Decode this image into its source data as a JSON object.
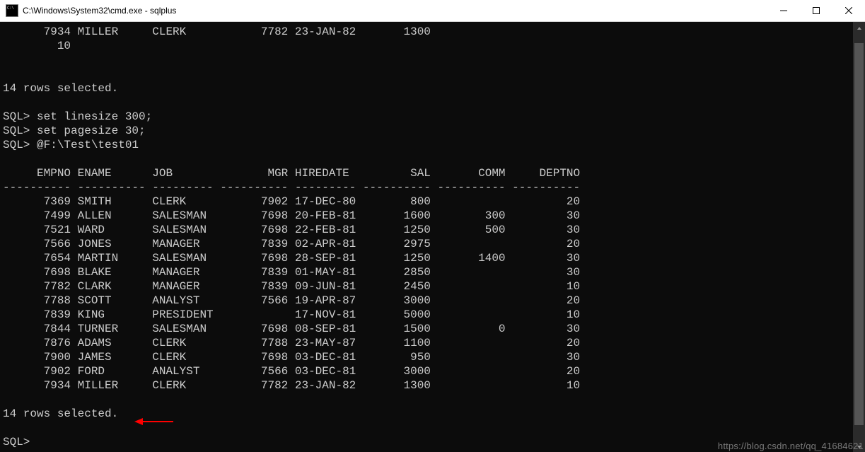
{
  "window": {
    "title": "C:\\Windows\\System32\\cmd.exe - sqlplus"
  },
  "scrollback_row": {
    "empno": "7934",
    "ename": "MILLER",
    "job": "CLERK",
    "mgr": "7782",
    "hiredate": "23-JAN-82",
    "sal": "1300",
    "comm": "",
    "deptno_wrapped": "10"
  },
  "status_above": "14 rows selected.",
  "commands": {
    "c1_prompt": "SQL>",
    "c1_text": "set linesize 300;",
    "c2_prompt": "SQL>",
    "c2_text": "set pagesize 30;",
    "c3_prompt": "SQL>",
    "c3_text": "@F:\\Test\\test01"
  },
  "headers": {
    "empno": "EMPNO",
    "ename": "ENAME",
    "job": "JOB",
    "mgr": "MGR",
    "hiredate": "HIREDATE",
    "sal": "SAL",
    "comm": "COMM",
    "deptno": "DEPTNO"
  },
  "rows": [
    {
      "empno": "7369",
      "ename": "SMITH",
      "job": "CLERK",
      "mgr": "7902",
      "hiredate": "17-DEC-80",
      "sal": "800",
      "comm": "",
      "deptno": "20"
    },
    {
      "empno": "7499",
      "ename": "ALLEN",
      "job": "SALESMAN",
      "mgr": "7698",
      "hiredate": "20-FEB-81",
      "sal": "1600",
      "comm": "300",
      "deptno": "30"
    },
    {
      "empno": "7521",
      "ename": "WARD",
      "job": "SALESMAN",
      "mgr": "7698",
      "hiredate": "22-FEB-81",
      "sal": "1250",
      "comm": "500",
      "deptno": "30"
    },
    {
      "empno": "7566",
      "ename": "JONES",
      "job": "MANAGER",
      "mgr": "7839",
      "hiredate": "02-APR-81",
      "sal": "2975",
      "comm": "",
      "deptno": "20"
    },
    {
      "empno": "7654",
      "ename": "MARTIN",
      "job": "SALESMAN",
      "mgr": "7698",
      "hiredate": "28-SEP-81",
      "sal": "1250",
      "comm": "1400",
      "deptno": "30"
    },
    {
      "empno": "7698",
      "ename": "BLAKE",
      "job": "MANAGER",
      "mgr": "7839",
      "hiredate": "01-MAY-81",
      "sal": "2850",
      "comm": "",
      "deptno": "30"
    },
    {
      "empno": "7782",
      "ename": "CLARK",
      "job": "MANAGER",
      "mgr": "7839",
      "hiredate": "09-JUN-81",
      "sal": "2450",
      "comm": "",
      "deptno": "10"
    },
    {
      "empno": "7788",
      "ename": "SCOTT",
      "job": "ANALYST",
      "mgr": "7566",
      "hiredate": "19-APR-87",
      "sal": "3000",
      "comm": "",
      "deptno": "20"
    },
    {
      "empno": "7839",
      "ename": "KING",
      "job": "PRESIDENT",
      "mgr": "",
      "hiredate": "17-NOV-81",
      "sal": "5000",
      "comm": "",
      "deptno": "10"
    },
    {
      "empno": "7844",
      "ename": "TURNER",
      "job": "SALESMAN",
      "mgr": "7698",
      "hiredate": "08-SEP-81",
      "sal": "1500",
      "comm": "0",
      "deptno": "30"
    },
    {
      "empno": "7876",
      "ename": "ADAMS",
      "job": "CLERK",
      "mgr": "7788",
      "hiredate": "23-MAY-87",
      "sal": "1100",
      "comm": "",
      "deptno": "20"
    },
    {
      "empno": "7900",
      "ename": "JAMES",
      "job": "CLERK",
      "mgr": "7698",
      "hiredate": "03-DEC-81",
      "sal": "950",
      "comm": "",
      "deptno": "30"
    },
    {
      "empno": "7902",
      "ename": "FORD",
      "job": "ANALYST",
      "mgr": "7566",
      "hiredate": "03-DEC-81",
      "sal": "3000",
      "comm": "",
      "deptno": "20"
    },
    {
      "empno": "7934",
      "ename": "MILLER",
      "job": "CLERK",
      "mgr": "7782",
      "hiredate": "23-JAN-82",
      "sal": "1300",
      "comm": "",
      "deptno": "10"
    }
  ],
  "status_below": "14 rows selected.",
  "prompt_final": "SQL>",
  "watermark": "https://blog.csdn.net/qq_41684621",
  "colwidths": {
    "empno": 10,
    "ename": 10,
    "job": 9,
    "mgr": 10,
    "hiredate": 9,
    "sal": 10,
    "comm": 10,
    "deptno": 10
  }
}
